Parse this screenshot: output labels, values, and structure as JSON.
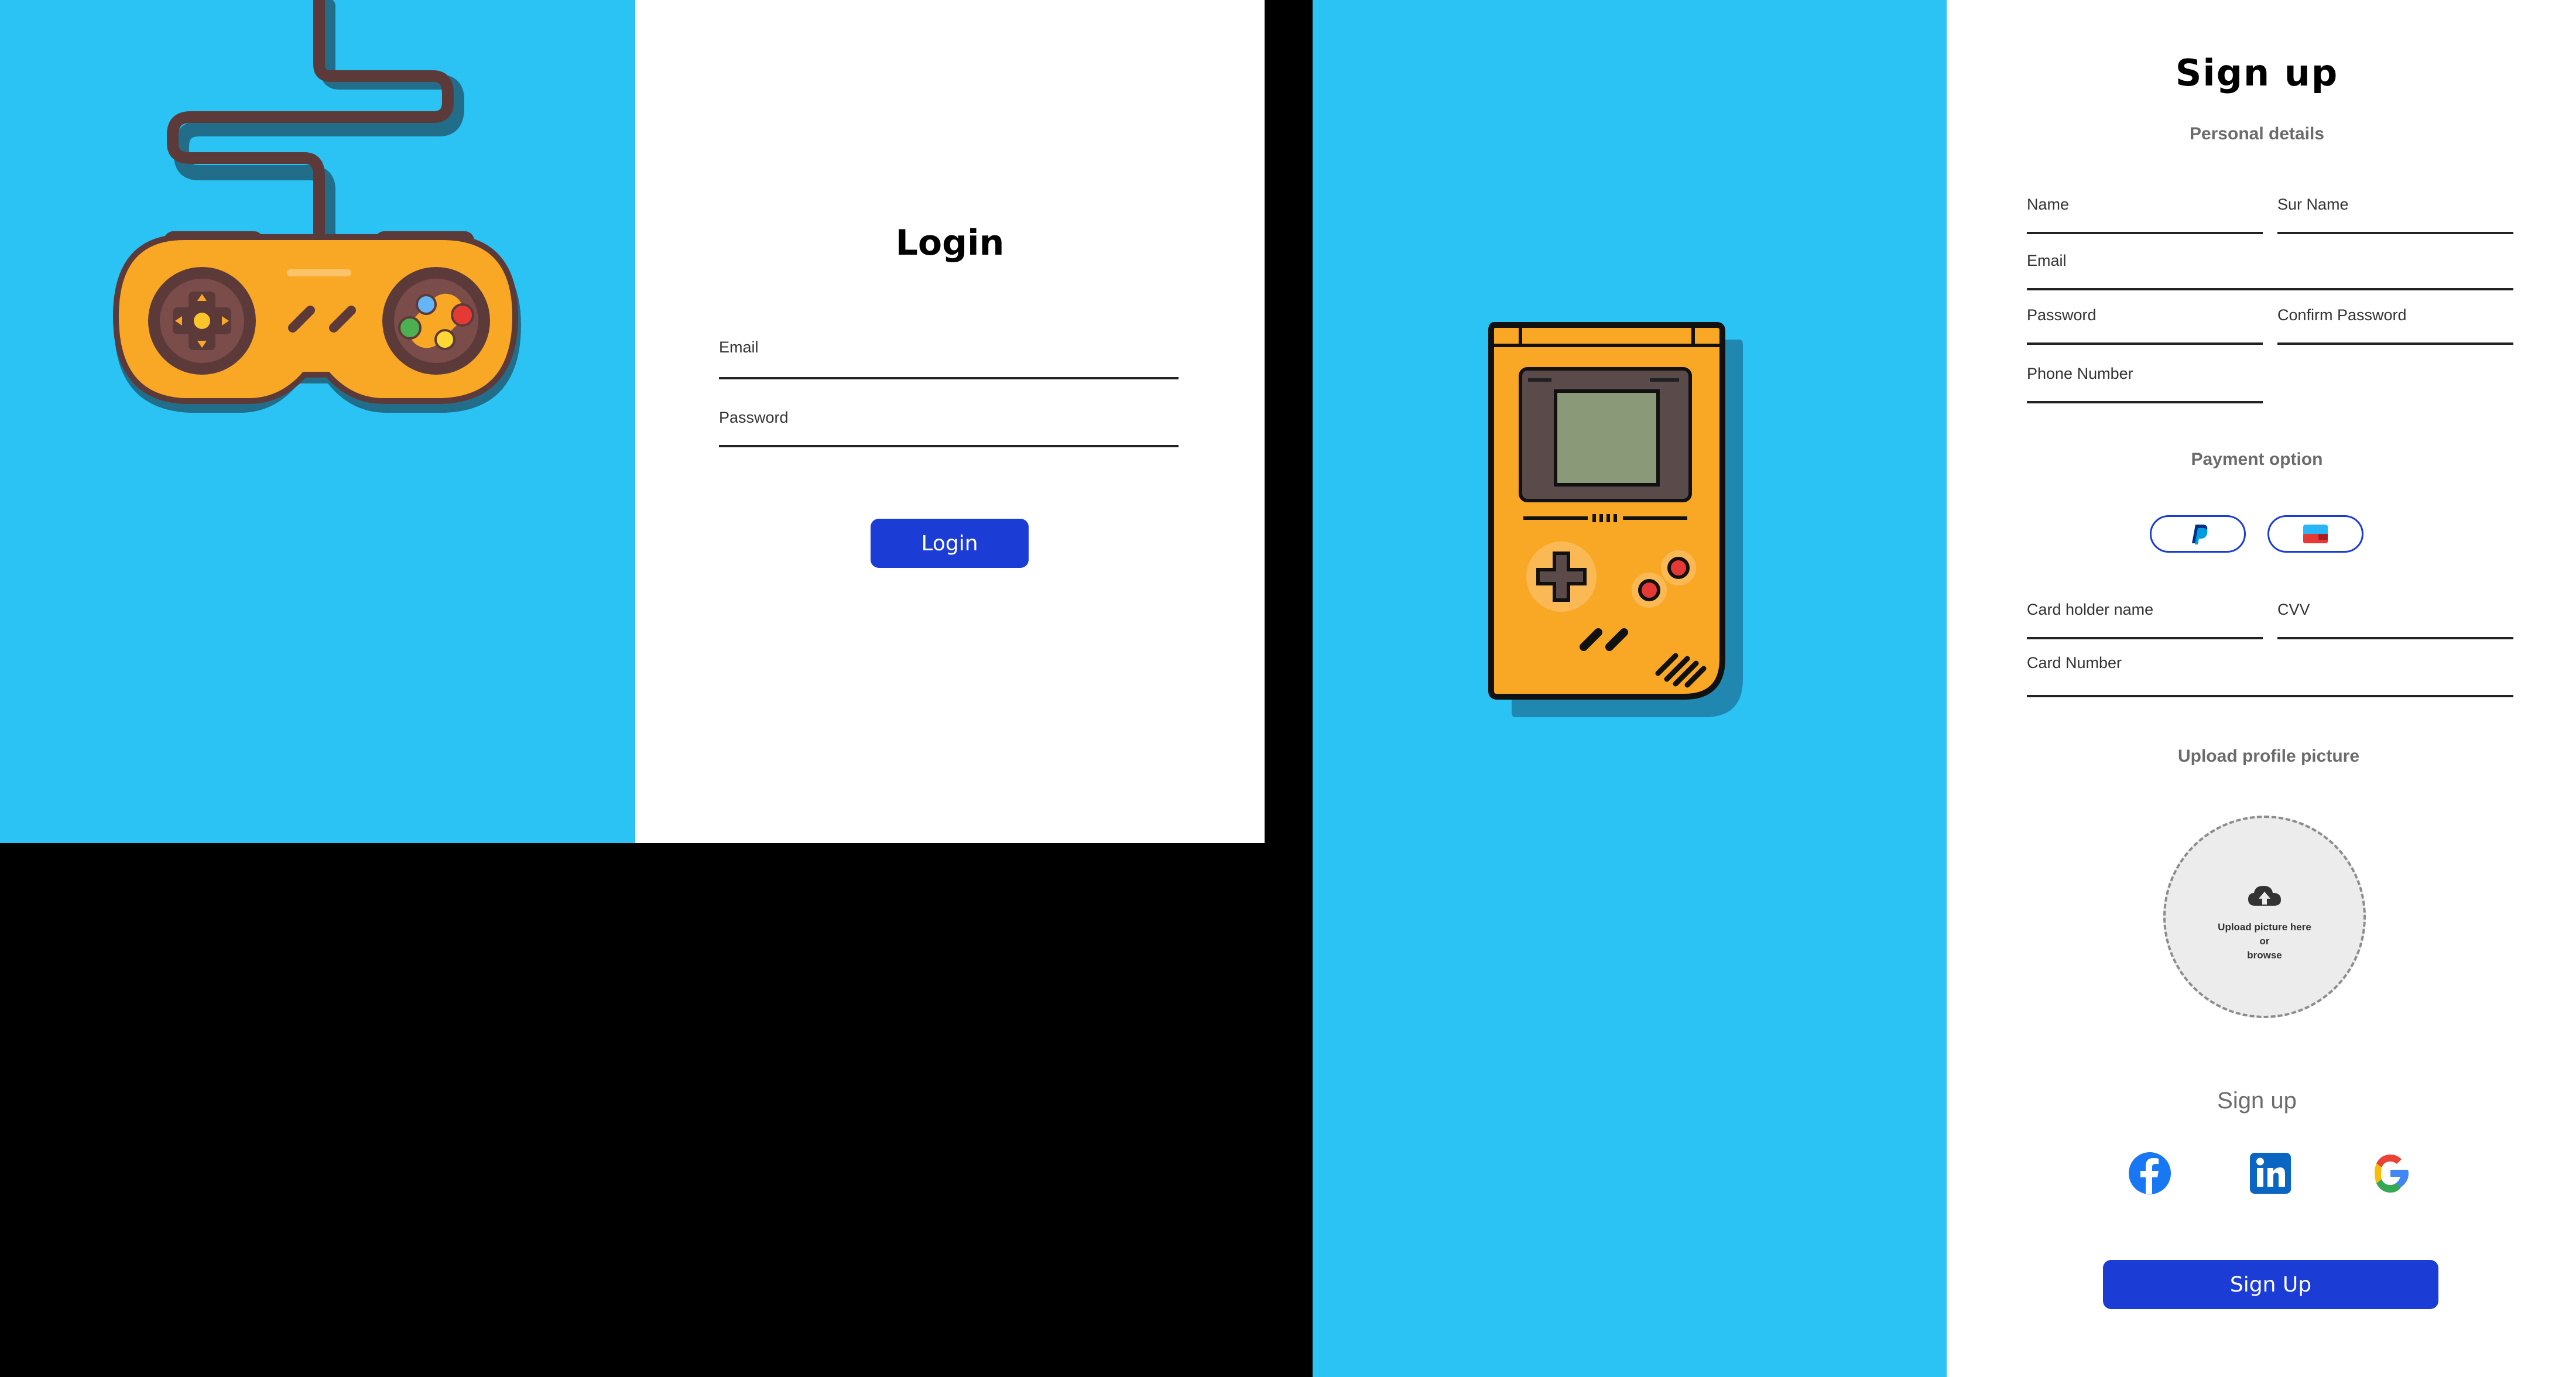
{
  "login": {
    "title": "Login",
    "fields": [
      {
        "label": "Email",
        "value": ""
      },
      {
        "label": "Password",
        "value": ""
      }
    ],
    "submit_label": "Login"
  },
  "signup": {
    "title": "Sign  up",
    "personal_details_heading": "Personal details",
    "fields": {
      "name": "Name",
      "surname": "Sur Name",
      "email": "Email",
      "password": "Password",
      "confirm_password": "Confirm Password",
      "phone": "Phone Number"
    },
    "payment_heading": "Payment option",
    "payment_options": [
      {
        "icon": "paypal-icon"
      },
      {
        "icon": "card-icon"
      }
    ],
    "card_fields": {
      "holder": "Card holder name",
      "cvv": "CVV",
      "number": "Card Number"
    },
    "upload_heading": "Upload profile picture",
    "upload": {
      "icon": "cloud-upload-icon",
      "line1": "Upload picture here",
      "line2": "or",
      "line3": "browse"
    },
    "social_heading": "Sign up",
    "social_providers": [
      {
        "icon": "facebook-icon"
      },
      {
        "icon": "linkedin-icon"
      },
      {
        "icon": "google-icon"
      }
    ],
    "submit_label": "Sign Up"
  },
  "colors": {
    "sky_blue": "#2bc3f3",
    "button_blue": "#1c3cd6",
    "controller_orange": "#f9a825",
    "controller_brown": "#5d3a3a"
  }
}
